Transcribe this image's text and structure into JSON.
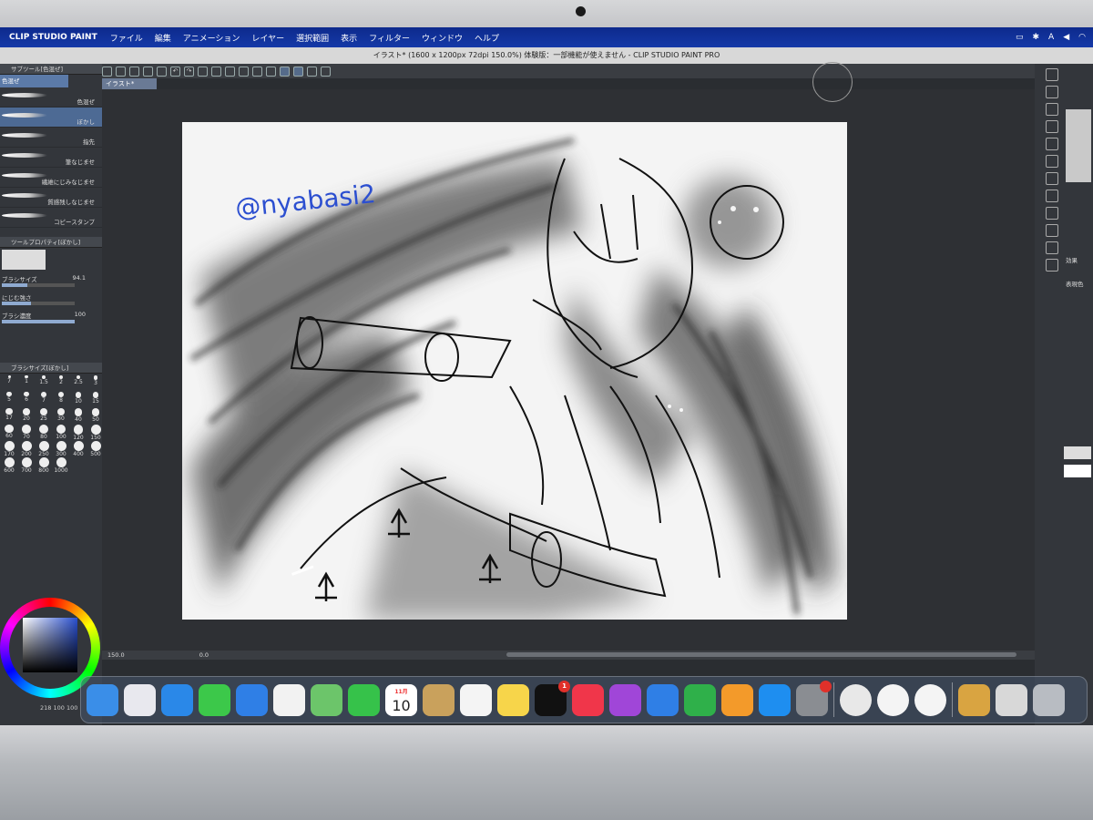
{
  "menubar": {
    "app_name": "CLIP STUDIO PAINT",
    "items": [
      "ファイル",
      "編集",
      "アニメーション",
      "レイヤー",
      "選択範囲",
      "表示",
      "フィルター",
      "ウィンドウ",
      "ヘルプ"
    ],
    "status_icons": [
      "display-icon",
      "bluetooth-icon",
      "input-A-icon",
      "volume-icon",
      "wifi-icon"
    ],
    "input_label": "A"
  },
  "window": {
    "title": "イラスト* (1600 x 1200px 72dpi 150.0%)  体験版：一部機能が使えません - CLIP STUDIO PAINT PRO",
    "doc_tab": "イラスト*"
  },
  "subtool": {
    "header": "サブツール[色混ぜ]",
    "active_group": "色混ぜ",
    "brushes": [
      {
        "label": "色混ぜ",
        "selected": false
      },
      {
        "label": "ぼかし",
        "selected": true
      },
      {
        "label": "指先",
        "selected": false
      },
      {
        "label": "筆なじませ",
        "selected": false
      },
      {
        "label": "繊維にじみなじませ",
        "selected": false
      },
      {
        "label": "質感残しなじませ",
        "selected": false
      },
      {
        "label": "コピースタンプ",
        "selected": false
      }
    ]
  },
  "tool_property": {
    "header": "ツールプロパティ[ぼかし]",
    "brush_size_label": "ブラシサイズ",
    "brush_size_value": "94.1",
    "brush_size_level": 0.35,
    "blur_strength_label": "にじむ強さ",
    "brush_density_label": "ブラシ濃度",
    "brush_density_value": "100",
    "brush_density_level": 1.0
  },
  "brush_size_palette": {
    "header": "ブラシサイズ[ぼかし]",
    "sizes": [
      "7",
      "1",
      "1.5",
      "2",
      "2.5",
      "3",
      "5",
      "6",
      "7",
      "8",
      "10",
      "15",
      "17",
      "20",
      "25",
      "30",
      "40",
      "50",
      "60",
      "70",
      "80",
      "100",
      "120",
      "150",
      "170",
      "200",
      "250",
      "300",
      "400",
      "500",
      "600",
      "700",
      "800",
      "1000"
    ]
  },
  "color": {
    "main": "#2a50d0",
    "readout": "218  100  100"
  },
  "canvas": {
    "watermark": "@nyabasi2",
    "zoom": "150.0",
    "rotation": "0.0"
  },
  "right_panel": {
    "effect_label": "効果",
    "display_color_label": "表現色"
  },
  "dock": {
    "calendar_month": "11月",
    "calendar_day": "10",
    "tv_badge": "1",
    "apps": [
      {
        "name": "finder",
        "color": "#3a8ee8"
      },
      {
        "name": "launchpad",
        "color": "#e8e8ee"
      },
      {
        "name": "safari",
        "color": "#2a88e8"
      },
      {
        "name": "messages",
        "color": "#3cc84a"
      },
      {
        "name": "mail",
        "color": "#2f7fe6"
      },
      {
        "name": "photos",
        "color": "#f2f2f2"
      },
      {
        "name": "maps",
        "color": "#6cc56a"
      },
      {
        "name": "facetime",
        "color": "#36c24a"
      },
      {
        "name": "calendar",
        "color": "#ffffff"
      },
      {
        "name": "contacts",
        "color": "#c9a15c"
      },
      {
        "name": "reminders",
        "color": "#f4f4f4"
      },
      {
        "name": "notes",
        "color": "#f7d54a"
      },
      {
        "name": "apple-tv",
        "color": "#111111"
      },
      {
        "name": "music",
        "color": "#f0364a"
      },
      {
        "name": "podcasts",
        "color": "#a046d8"
      },
      {
        "name": "keynote",
        "color": "#2f7fe6"
      },
      {
        "name": "numbers",
        "color": "#2fb04a"
      },
      {
        "name": "pages",
        "color": "#f39a2a"
      },
      {
        "name": "app-store",
        "color": "#1e8ef0"
      },
      {
        "name": "system-preferences",
        "color": "#8a8d92"
      },
      {
        "name": "clip-studio",
        "color": "#e8e8e8"
      },
      {
        "name": "clip-studio-paint",
        "color": "#f4f4f4"
      },
      {
        "name": "word-app",
        "color": "#f4f4f4"
      },
      {
        "name": "archive-utility",
        "color": "#d9a441"
      },
      {
        "name": "preview",
        "color": "#d8d8d8"
      },
      {
        "name": "trash",
        "color": "#b8bcc2"
      }
    ]
  }
}
